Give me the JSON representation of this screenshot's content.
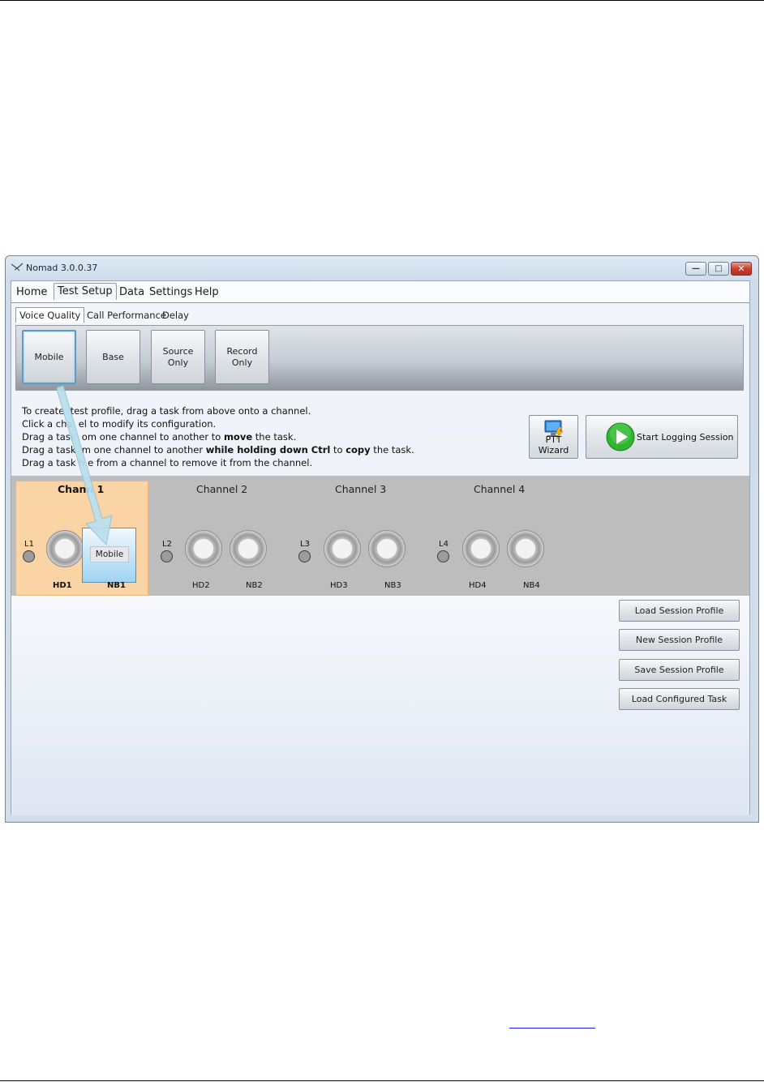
{
  "window": {
    "title": "Nomad 3.0.0.37",
    "controls": {
      "minimize": "—",
      "maximize": "□",
      "close": "✕"
    }
  },
  "menu": {
    "items": [
      "Home",
      "Test Setup",
      "Data",
      "Settings",
      "Help"
    ],
    "active": "Test Setup"
  },
  "subtabs": {
    "items": [
      "Voice Quality",
      "Call Performance",
      "Delay"
    ],
    "active": "Voice Quality"
  },
  "tasks": [
    {
      "label": "Mobile",
      "selected": true
    },
    {
      "label": "Base",
      "selected": false
    },
    {
      "label": "Source\nOnly",
      "selected": false
    },
    {
      "label": "Record\nOnly",
      "selected": false
    }
  ],
  "instructions": {
    "line1": "To create  test profile, drag a task from above onto a channel.",
    "line2": "Click a cha  el to modify its configuration.",
    "line3a": "Drag a task  om one channel to another to ",
    "line3b": "move",
    "line3c": " the task.",
    "line4a": "Drag a task  m one channel to another ",
    "line4b": "while holding down Ctrl",
    "line4c": " to ",
    "line4d": "copy",
    "line4e": " the task.",
    "line5": "Drag a task h e from a channel to remove it from the channel."
  },
  "actions": {
    "ptt_wizard": "PTT Wizard",
    "start_logging": "Start Logging Session"
  },
  "channels": [
    {
      "title": "Chann  1",
      "led": "L1",
      "hd": "HD1",
      "nb": "NB1",
      "selected": true,
      "assigned_task": "Mobile"
    },
    {
      "title": "Channel 2",
      "led": "L2",
      "hd": "HD2",
      "nb": "NB2",
      "selected": false
    },
    {
      "title": "Channel 3",
      "led": "L3",
      "hd": "HD3",
      "nb": "NB3",
      "selected": false
    },
    {
      "title": "Channel 4",
      "led": "L4",
      "hd": "HD4",
      "nb": "NB4",
      "selected": false
    }
  ],
  "side_buttons": [
    "Load Session Profile",
    "New Session Profile",
    "Save Session Profile",
    "Load Configured Task"
  ],
  "colors": {
    "channel_selected_bg": "#fad4a4",
    "channel_strip_bg": "#bdbdbd",
    "drag_arrow": "#b9dfee",
    "start_icon_green": "#2fb52f"
  }
}
